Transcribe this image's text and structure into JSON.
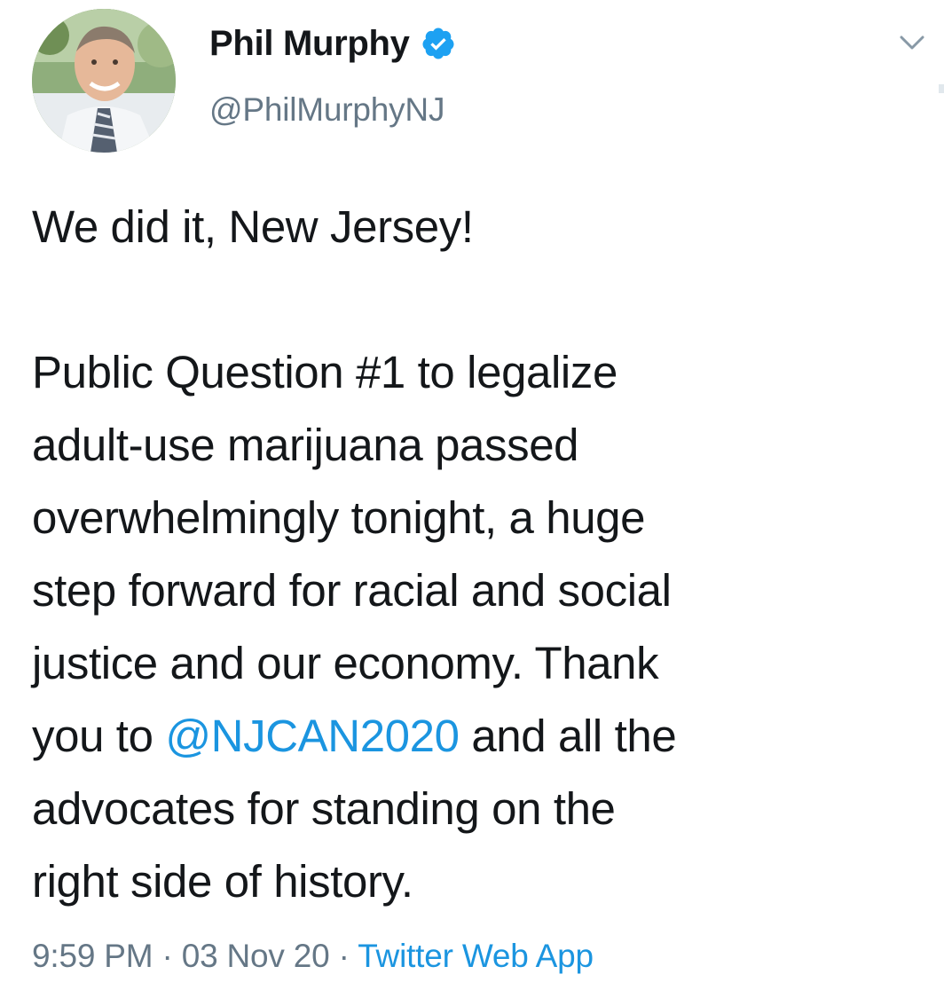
{
  "author": {
    "name": "Phil Murphy",
    "handle": "@PhilMurphyNJ",
    "verified": true
  },
  "tweet": {
    "line1": "We did it, New Jersey!",
    "line2": "Public Question #1 to legalize",
    "line3": "adult-use marijuana passed",
    "line4": "overwhelmingly tonight, a huge",
    "line5": "step forward for racial and social",
    "line6": "justice and our economy. Thank",
    "line7_before": "you to ",
    "line7_mention": "@NJCAN2020",
    "line7_after": " and all the",
    "line8": "advocates for standing on the",
    "line9": "right side of history."
  },
  "meta": {
    "time": "9:59 PM",
    "sep1": " · ",
    "date": "03 Nov 20",
    "sep2": " · ",
    "source": "Twitter Web App"
  },
  "colors": {
    "text": "#14171a",
    "secondary": "#657786",
    "link": "#1b95e0",
    "verified": "#1da1f2"
  },
  "icons": {
    "verified": "verified-badge-icon",
    "caret": "chevron-down-icon"
  }
}
